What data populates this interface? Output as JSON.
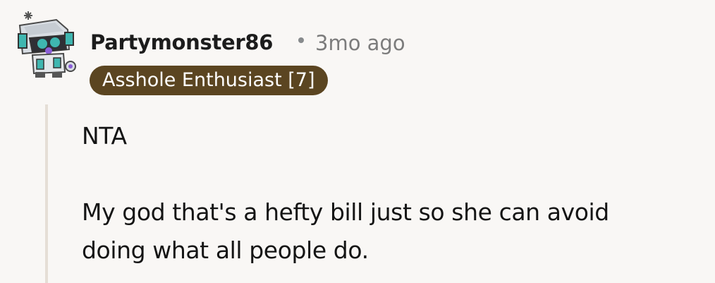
{
  "comment": {
    "avatar_icon": "snoo-robot-avatar-icon",
    "username": "Partymonster86",
    "separator": "•",
    "timestamp": "3mo ago",
    "flair": "Asshole Enthusiast [7]",
    "flair_color": "#5b4521",
    "thread_line_color": "#e5ded6",
    "body": {
      "paragraph_1": "NTA",
      "paragraph_2_line_1": "My god that's a hefty bill just so she can avoid",
      "paragraph_2_line_2": "doing what all people do."
    }
  }
}
